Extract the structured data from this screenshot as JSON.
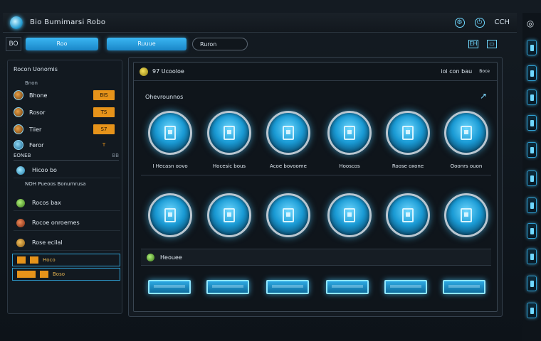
{
  "window": {
    "title": "Bio Bumimarsi Robo",
    "controls": [
      "settings",
      "close"
    ],
    "right_label": "CCH"
  },
  "toolbar": {
    "left_box": "BO",
    "tab1": "Roo",
    "tab2": "Ruuue",
    "search_value": "Ruron",
    "right_box": "EH"
  },
  "sidebar": {
    "header": "Rocon Uonomis",
    "subheader": "Bnon",
    "items": [
      {
        "label": "Bhone",
        "value": "BIS",
        "icon": "orange"
      },
      {
        "label": "Rosor",
        "value": "TS",
        "icon": "orange"
      },
      {
        "label": "Tiier",
        "value": "S7",
        "icon": "orange"
      },
      {
        "label": "Feror",
        "value": "T",
        "icon": "blue",
        "value_style": "dark"
      }
    ],
    "separator_label": "EONEB",
    "separator_right": "BB",
    "nodes": [
      {
        "label": "Hicoo bo",
        "color": "blue"
      }
    ],
    "info": "NOH Pueoos Bonumrusa",
    "sub_nodes": [
      {
        "label": "Rocos bax",
        "color": "g"
      },
      {
        "label": "Rocoe onroemes",
        "color": "r"
      },
      {
        "label": "Rose ecilal",
        "color": "o"
      }
    ],
    "strips": [
      {
        "label": "Hoco"
      },
      {
        "label": "Boso"
      }
    ]
  },
  "main": {
    "title": "97 Ucooloe",
    "header_right": "ioi con bau",
    "header_mini": "Boce",
    "section_label": "Ohevrounnos",
    "gauge_row1_labels": [
      "I Hecasn oovo",
      "Hocesic bous",
      "Acoe bovoome",
      "Hooscos",
      "Roose oxone",
      "Ooonrs ouon"
    ],
    "gauge_row2_labels": [
      "",
      "",
      "",
      "",
      "",
      ""
    ],
    "sub_section_label": "Heouee",
    "action_buttons": [
      "",
      "",
      "",
      "",
      "",
      ""
    ]
  },
  "colors": {
    "accent": "#2da8e2",
    "accent_glow": "#6fd8ff",
    "orange": "#e6931a",
    "background": "#0b1016"
  }
}
